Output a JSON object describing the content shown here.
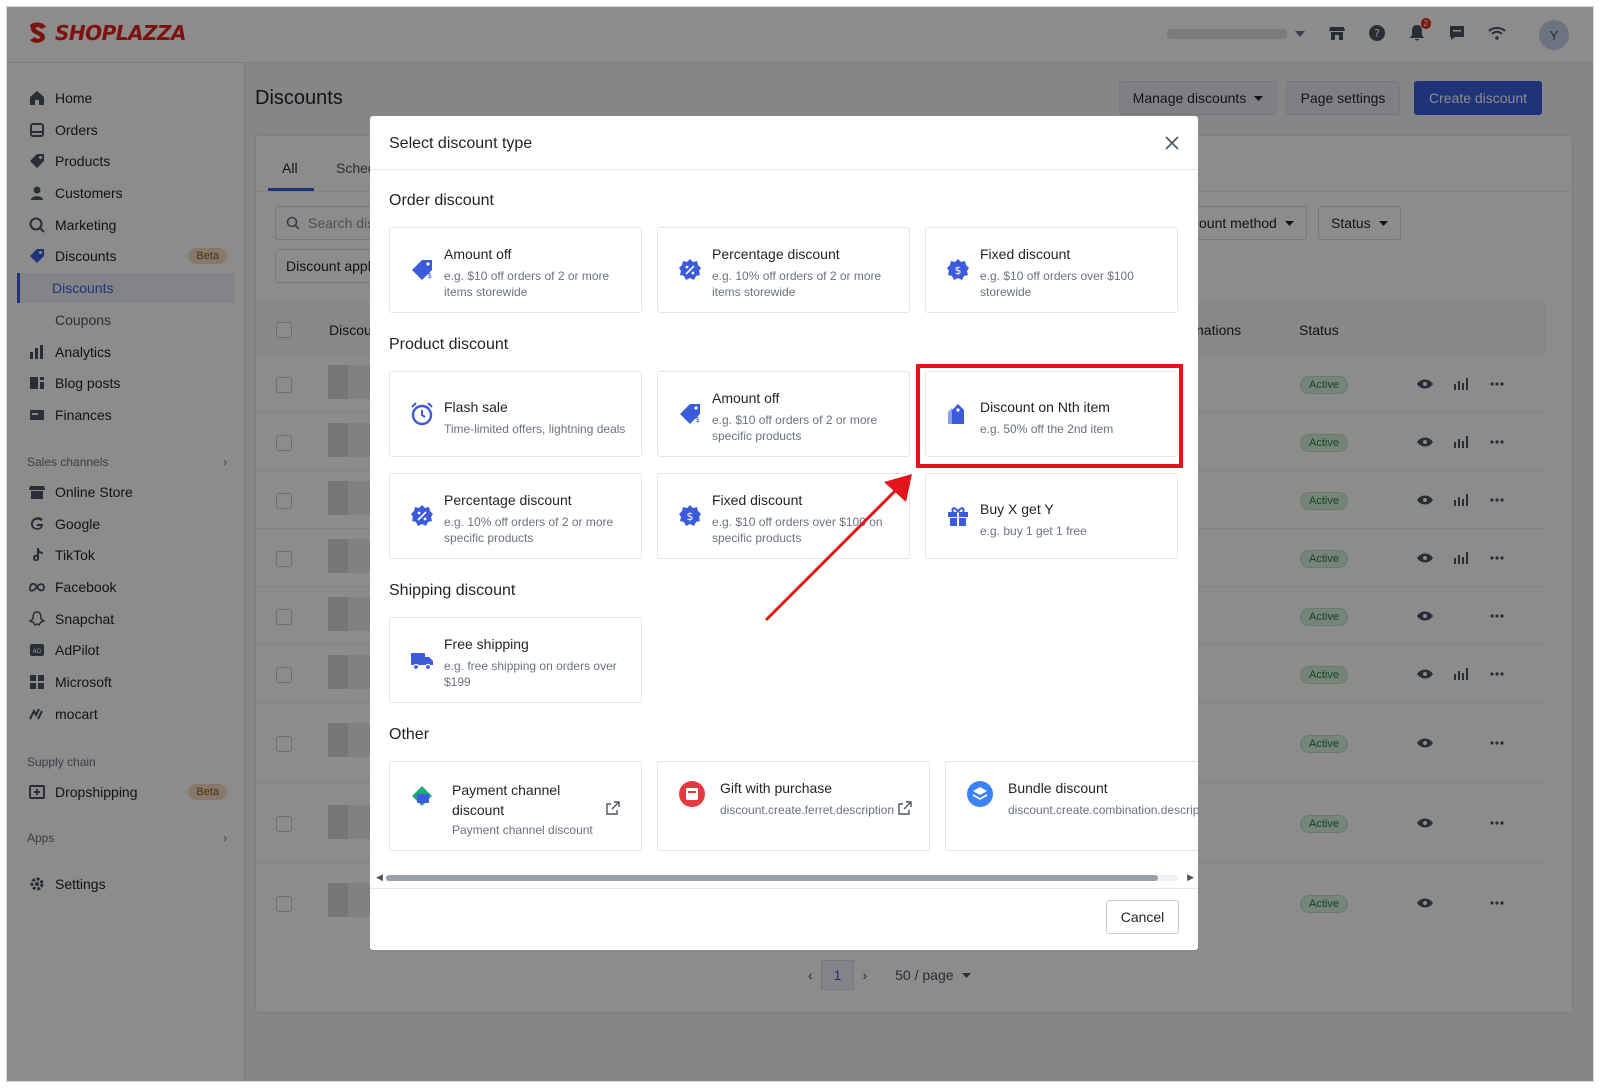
{
  "brand": {
    "logo_text": "SHOPLAZZA",
    "accent": "#3b5bdb",
    "brand_red": "#e2231a"
  },
  "topbar": {
    "icons": [
      "store-icon",
      "help-icon",
      "bell-icon",
      "chat-icon",
      "wifi-icon"
    ],
    "notification_count": "2",
    "avatar_initial": "Y"
  },
  "sidebar": {
    "items": [
      {
        "label": "Home",
        "icon": "home-icon"
      },
      {
        "label": "Orders",
        "icon": "orders-icon"
      },
      {
        "label": "Products",
        "icon": "tag-icon"
      },
      {
        "label": "Customers",
        "icon": "person-icon"
      },
      {
        "label": "Marketing",
        "icon": "marketing-icon"
      },
      {
        "label": "Discounts",
        "icon": "discount-icon",
        "badge": "Beta"
      },
      {
        "label": "Discounts",
        "sub": true,
        "active": true
      },
      {
        "label": "Coupons",
        "sub": true
      },
      {
        "label": "Analytics",
        "icon": "analytics-icon"
      },
      {
        "label": "Blog posts",
        "icon": "blog-icon"
      },
      {
        "label": "Finances",
        "icon": "finance-icon"
      }
    ],
    "sales_channels_label": "Sales channels",
    "channels": [
      {
        "label": "Online Store"
      },
      {
        "label": "Google"
      },
      {
        "label": "TikTok"
      },
      {
        "label": "Facebook"
      },
      {
        "label": "Snapchat"
      },
      {
        "label": "AdPilot"
      },
      {
        "label": "Microsoft"
      },
      {
        "label": "mocart"
      }
    ],
    "supply_chain_label": "Supply chain",
    "dropshipping": {
      "label": "Dropshipping",
      "badge": "Beta"
    },
    "apps_label": "Apps",
    "settings_label": "Settings"
  },
  "page": {
    "title": "Discounts",
    "manage_btn": "Manage discounts",
    "page_settings_btn": "Page settings",
    "create_btn": "Create discount",
    "tabs": [
      "All",
      "Sched"
    ],
    "search_placeholder": "Search disc",
    "filter_discount_app": "Discount appl",
    "filter_method": "ount method",
    "filter_status": "Status",
    "col_discount": "Discou",
    "col_combinations": "nations",
    "col_status": "Status",
    "row_status": "Active",
    "pager_page": "1",
    "pager_size": "50 / page"
  },
  "modal": {
    "title": "Select discount type",
    "sections": {
      "order": {
        "title": "Order discount",
        "options": [
          {
            "title": "Amount off",
            "desc": "e.g. $10 off orders of 2 or more items storewide"
          },
          {
            "title": "Percentage discount",
            "desc": "e.g. 10% off orders of 2 or more items storewide"
          },
          {
            "title": "Fixed discount",
            "desc": "e.g. $10 off orders over $100 storewide"
          }
        ]
      },
      "product": {
        "title": "Product discount",
        "options": [
          {
            "title": "Flash sale",
            "desc": "Time-limited offers, lightning deals"
          },
          {
            "title": "Amount off",
            "desc": "e.g. $10 off orders of 2 or more specific products"
          },
          {
            "title": "Discount on Nth item",
            "desc": "e.g. 50% off the 2nd item"
          },
          {
            "title": "Percentage discount",
            "desc": "e.g. 10% off orders of 2 or more specific products"
          },
          {
            "title": "Fixed discount",
            "desc": "e.g. $10 off orders over $100 on specific products"
          },
          {
            "title": "Buy X get Y",
            "desc": "e.g. buy 1 get 1 free"
          }
        ]
      },
      "shipping": {
        "title": "Shipping discount",
        "options": [
          {
            "title": "Free shipping",
            "desc": "e.g. free shipping on orders over $199"
          }
        ]
      },
      "other": {
        "title": "Other",
        "options": [
          {
            "title": "Payment channel discount",
            "desc": "Payment channel discount"
          },
          {
            "title": "Gift with purchase",
            "desc": "discount.create.ferret.description"
          },
          {
            "title": "Bundle discount",
            "desc": "discount.create.combination.description"
          }
        ]
      }
    },
    "cancel_label": "Cancel"
  }
}
